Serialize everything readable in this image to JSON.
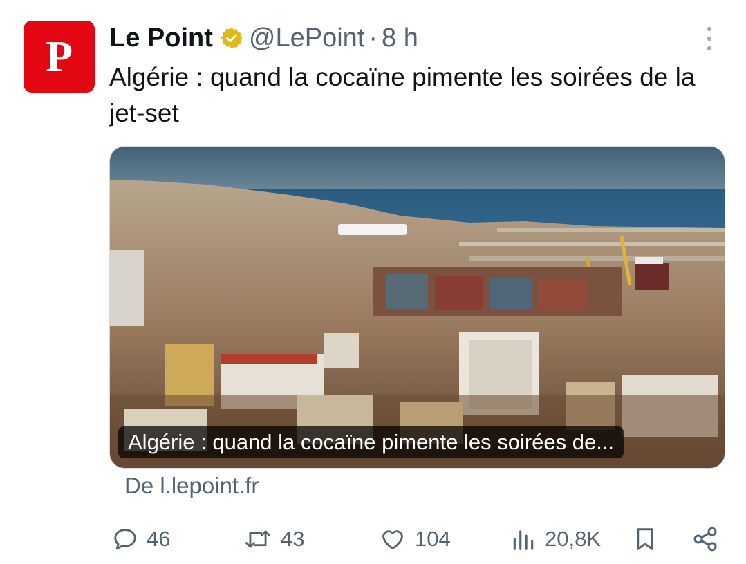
{
  "tweet": {
    "avatar_letter": "P",
    "author_name": "Le Point",
    "handle": "@LePoint",
    "separator": "·",
    "time": "8 h",
    "text": "Algérie : quand la cocaïne pimente les soirées de la jet-set"
  },
  "card": {
    "caption": "Algérie : quand la cocaïne pimente les soirées de...",
    "source": "De l.lepoint.fr"
  },
  "actions": {
    "replies": "46",
    "retweets": "43",
    "likes": "104",
    "views": "20,8K"
  },
  "colors": {
    "brand_red": "#e30613",
    "verified_gold": "#e2b719",
    "muted_text": "#536471",
    "primary_text": "#0f1419"
  },
  "icons": {
    "more": "more-vertical-icon",
    "verified": "verified-badge-icon",
    "reply": "reply-icon",
    "retweet": "retweet-icon",
    "like": "heart-icon",
    "views": "views-chart-icon",
    "bookmark": "bookmark-icon",
    "share": "share-icon"
  }
}
